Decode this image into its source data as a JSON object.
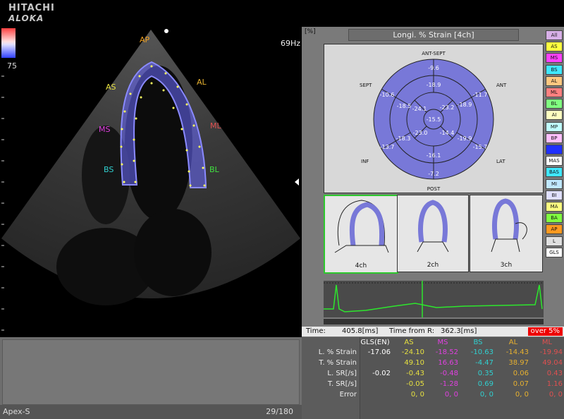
{
  "header": {
    "brand_line1": "HITACHI",
    "brand_line2": "ALOKA"
  },
  "image": {
    "scale_value": "75",
    "frame_rate": "69Hz",
    "segments": [
      {
        "label": "AP",
        "color": "#f0a020"
      },
      {
        "label": "AS",
        "color": "#e6e040"
      },
      {
        "label": "AL",
        "color": "#e6b030"
      },
      {
        "label": "MS",
        "color": "#e040e0"
      },
      {
        "label": "ML",
        "color": "#e05050"
      },
      {
        "label": "BS",
        "color": "#30d0d0"
      },
      {
        "label": "BL",
        "color": "#40e040"
      }
    ]
  },
  "footer": {
    "view": "Apex-S",
    "frame": "29/180"
  },
  "panel": {
    "units": "[%]",
    "title": "Longi. % Strain [4ch]",
    "bullseye": {
      "labels": {
        "top": "ANT-SEPT",
        "bottom": "POST",
        "sept": "SEPT",
        "ant": "ANT",
        "inf": "INF",
        "lat": "LAT"
      },
      "outer": [
        "-9.6",
        "-11.7",
        "-15.7",
        "-7.2",
        "-13.7",
        "-10.6"
      ],
      "middle": [
        "-18.9",
        "-18.9",
        "-19.9",
        "-16.1",
        "-18.3",
        "-18.5"
      ],
      "inner": [
        "-23.2",
        "-14.4",
        "-23.0",
        "-24.1"
      ],
      "center": "-15.5"
    },
    "views": [
      "4ch",
      "2ch",
      "3ch"
    ]
  },
  "legend": [
    {
      "label": "All",
      "color": "#d8b0e8"
    },
    {
      "label": "AS",
      "color": "#ffff40"
    },
    {
      "label": "MS",
      "color": "#ff40ff"
    },
    {
      "label": "BS",
      "color": "#40e8ff"
    },
    {
      "label": "AL",
      "color": "#ffc880"
    },
    {
      "label": "ML",
      "color": "#ff8080"
    },
    {
      "label": "BL",
      "color": "#80ff80"
    },
    {
      "label": "AI",
      "color": "#ffffc0"
    },
    {
      "label": "MP",
      "color": "#c0ffff"
    },
    {
      "label": "BP",
      "color": "#ffc0ff"
    },
    {
      "label": "",
      "color": "#2030ff"
    },
    {
      "label": "MAS",
      "color": "#ffffff"
    },
    {
      "label": "BAS",
      "color": "#40e8ff"
    },
    {
      "label": "MI",
      "color": "#c0e8ff"
    },
    {
      "label": "BI",
      "color": "#e0e0ff"
    },
    {
      "label": "MA",
      "color": "#ffff80"
    },
    {
      "label": "BA",
      "color": "#80ff40"
    },
    {
      "label": "AP",
      "color": "#ff9a20"
    },
    {
      "label": "L",
      "color": "#e0e0e0"
    },
    {
      "label": "GLS",
      "color": "#ffffff"
    }
  ],
  "timing": {
    "time_label": "Time:",
    "time_value": "405.8[ms]",
    "from_r_label": "Time from R:",
    "from_r_value": "362.3[ms]",
    "over_label": "over 5%"
  },
  "table": {
    "columns": [
      {
        "label": "GLS(EN)",
        "color": "#ffffff"
      },
      {
        "label": "AS",
        "color": "#e6e040"
      },
      {
        "label": "MS",
        "color": "#e040e0"
      },
      {
        "label": "BS",
        "color": "#30d0d0"
      },
      {
        "label": "AL",
        "color": "#e6b030"
      },
      {
        "label": "ML",
        "color": "#e05050"
      }
    ],
    "rows": [
      {
        "label": "L. % Strain",
        "values": [
          "-17.06",
          "-24.10",
          "-18.52",
          "-10.63",
          "-14.43",
          "-19.94"
        ]
      },
      {
        "label": "T. % Strain",
        "values": [
          "",
          "49.10",
          "16.63",
          "-4.47",
          "38.97",
          "49.04"
        ]
      },
      {
        "label": "L. SR[/s]",
        "values": [
          "-0.02",
          "-0.43",
          "-0.48",
          "0.35",
          "0.06",
          "0.43"
        ]
      },
      {
        "label": "T. SR[/s]",
        "values": [
          "",
          "-0.05",
          "-1.28",
          "0.69",
          "0.07",
          "1.16"
        ]
      },
      {
        "label": "Error",
        "values": [
          "",
          "0, 0",
          "0, 0",
          "0, 0",
          "0, 0",
          "0, 0"
        ]
      }
    ]
  }
}
